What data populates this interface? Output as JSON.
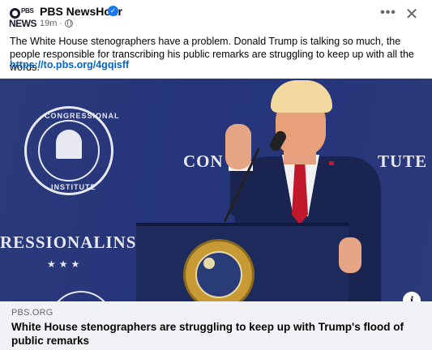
{
  "post": {
    "page_name": "PBS NewsHour",
    "avatar_top": "PBS",
    "avatar_bottom": "NEWS",
    "verified_mark": "✓",
    "time_ago": "19m",
    "audience_dot": "·",
    "more_label": "•••",
    "close_label": "✕",
    "body_text": "The White House stenographers have a problem. Donald Trump is talking so much, the people responsible for transcribing his public remarks are struggling to keep up with all the words.",
    "link_text": "https://to.pbs.org/4gqisff"
  },
  "photo": {
    "backdrop_left": "RESSIONALINSTI",
    "backdrop_right": "CON",
    "backdrop_right2": "TUTE",
    "seal_top_text": "CONGRESSIONAL",
    "seal_bottom_text": "INSTITUTE",
    "stars": "★★★",
    "info_label": "i"
  },
  "link_preview": {
    "domain": "PBS.ORG",
    "headline": "White House stenographers are struggling to keep up with Trump's flood of public remarks"
  },
  "icons": {
    "avatar": "pbs-newshour-logo",
    "verified": "verified-badge-icon",
    "audience": "globe-icon",
    "more": "more-options-icon",
    "close": "close-icon",
    "info": "info-icon"
  },
  "colors": {
    "link": "#0064d1",
    "verified": "#1877f2",
    "preview_bg": "#f0f2f5",
    "secondary_text": "#65676b"
  }
}
